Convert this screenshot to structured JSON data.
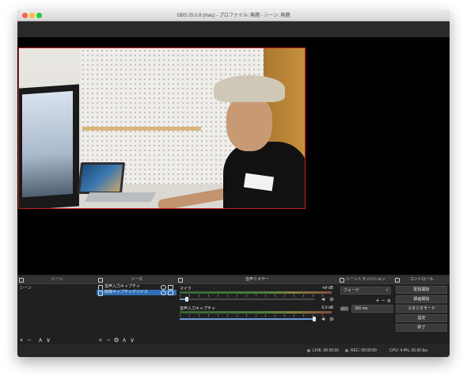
{
  "window": {
    "title": "OBS 25.0.8 (mac) - プロファイル: 無題 - シーン: 無題"
  },
  "docks": {
    "scenes": {
      "title": "シーン",
      "items": [
        "シーン"
      ],
      "toolbar": [
        "+",
        "−",
        "∧",
        "∨"
      ]
    },
    "sources": {
      "title": "ソース",
      "items": [
        {
          "label": "音声入力キャプチャ",
          "selected": false
        },
        {
          "label": "映像キャプチャデバイス",
          "selected": true
        }
      ],
      "toolbar": [
        "+",
        "−",
        "⚙",
        "∧",
        "∨"
      ]
    },
    "mixer": {
      "title": "音声ミキサー",
      "channels": [
        {
          "name": "マイク",
          "db": "-inf dB",
          "volume": 0.05
        },
        {
          "name": "音声入力キャプチャ",
          "db": "0.0 dB",
          "volume": 1.0
        }
      ]
    },
    "transitions": {
      "title": "シーントランジション",
      "selected": "フェード",
      "duration_label": "期間",
      "duration_value": "300 ms"
    },
    "controls": {
      "title": "コントロール",
      "buttons": [
        "配信開始",
        "録画開始",
        "スタジオモード",
        "設定",
        "終了"
      ]
    }
  },
  "status": {
    "live": "LIVE: 00:00:00",
    "rec": "REC: 00:00:00",
    "cpu": "CPU: 4.4%, 30.00 fps"
  },
  "colors": {
    "accent": "#2f6fb6",
    "selection_border": "#c81e1e"
  },
  "icons": {
    "mic": "microphone-icon",
    "camera": "camera-icon",
    "eye": "eye-icon",
    "lock": "lock-icon",
    "speaker": "speaker-icon",
    "gear": "gear-icon"
  }
}
